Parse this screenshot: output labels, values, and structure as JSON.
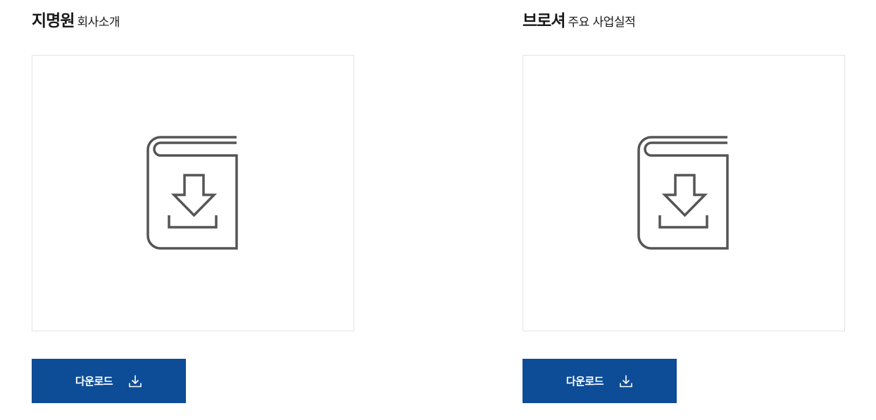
{
  "cards": [
    {
      "title_main": "지명원",
      "title_sub": "회사소개",
      "preview_icon": "book-download-icon",
      "button_label": "다운로드",
      "button_icon": "download-icon"
    },
    {
      "title_main": "브로셔",
      "title_sub": "주요 사업실적",
      "preview_icon": "book-download-icon",
      "button_label": "다운로드",
      "button_icon": "download-icon"
    }
  ],
  "colors": {
    "button_bg": "#0d4c97",
    "button_text": "#ffffff",
    "icon_stroke": "#555555",
    "card_border": "#e3e3e3"
  }
}
